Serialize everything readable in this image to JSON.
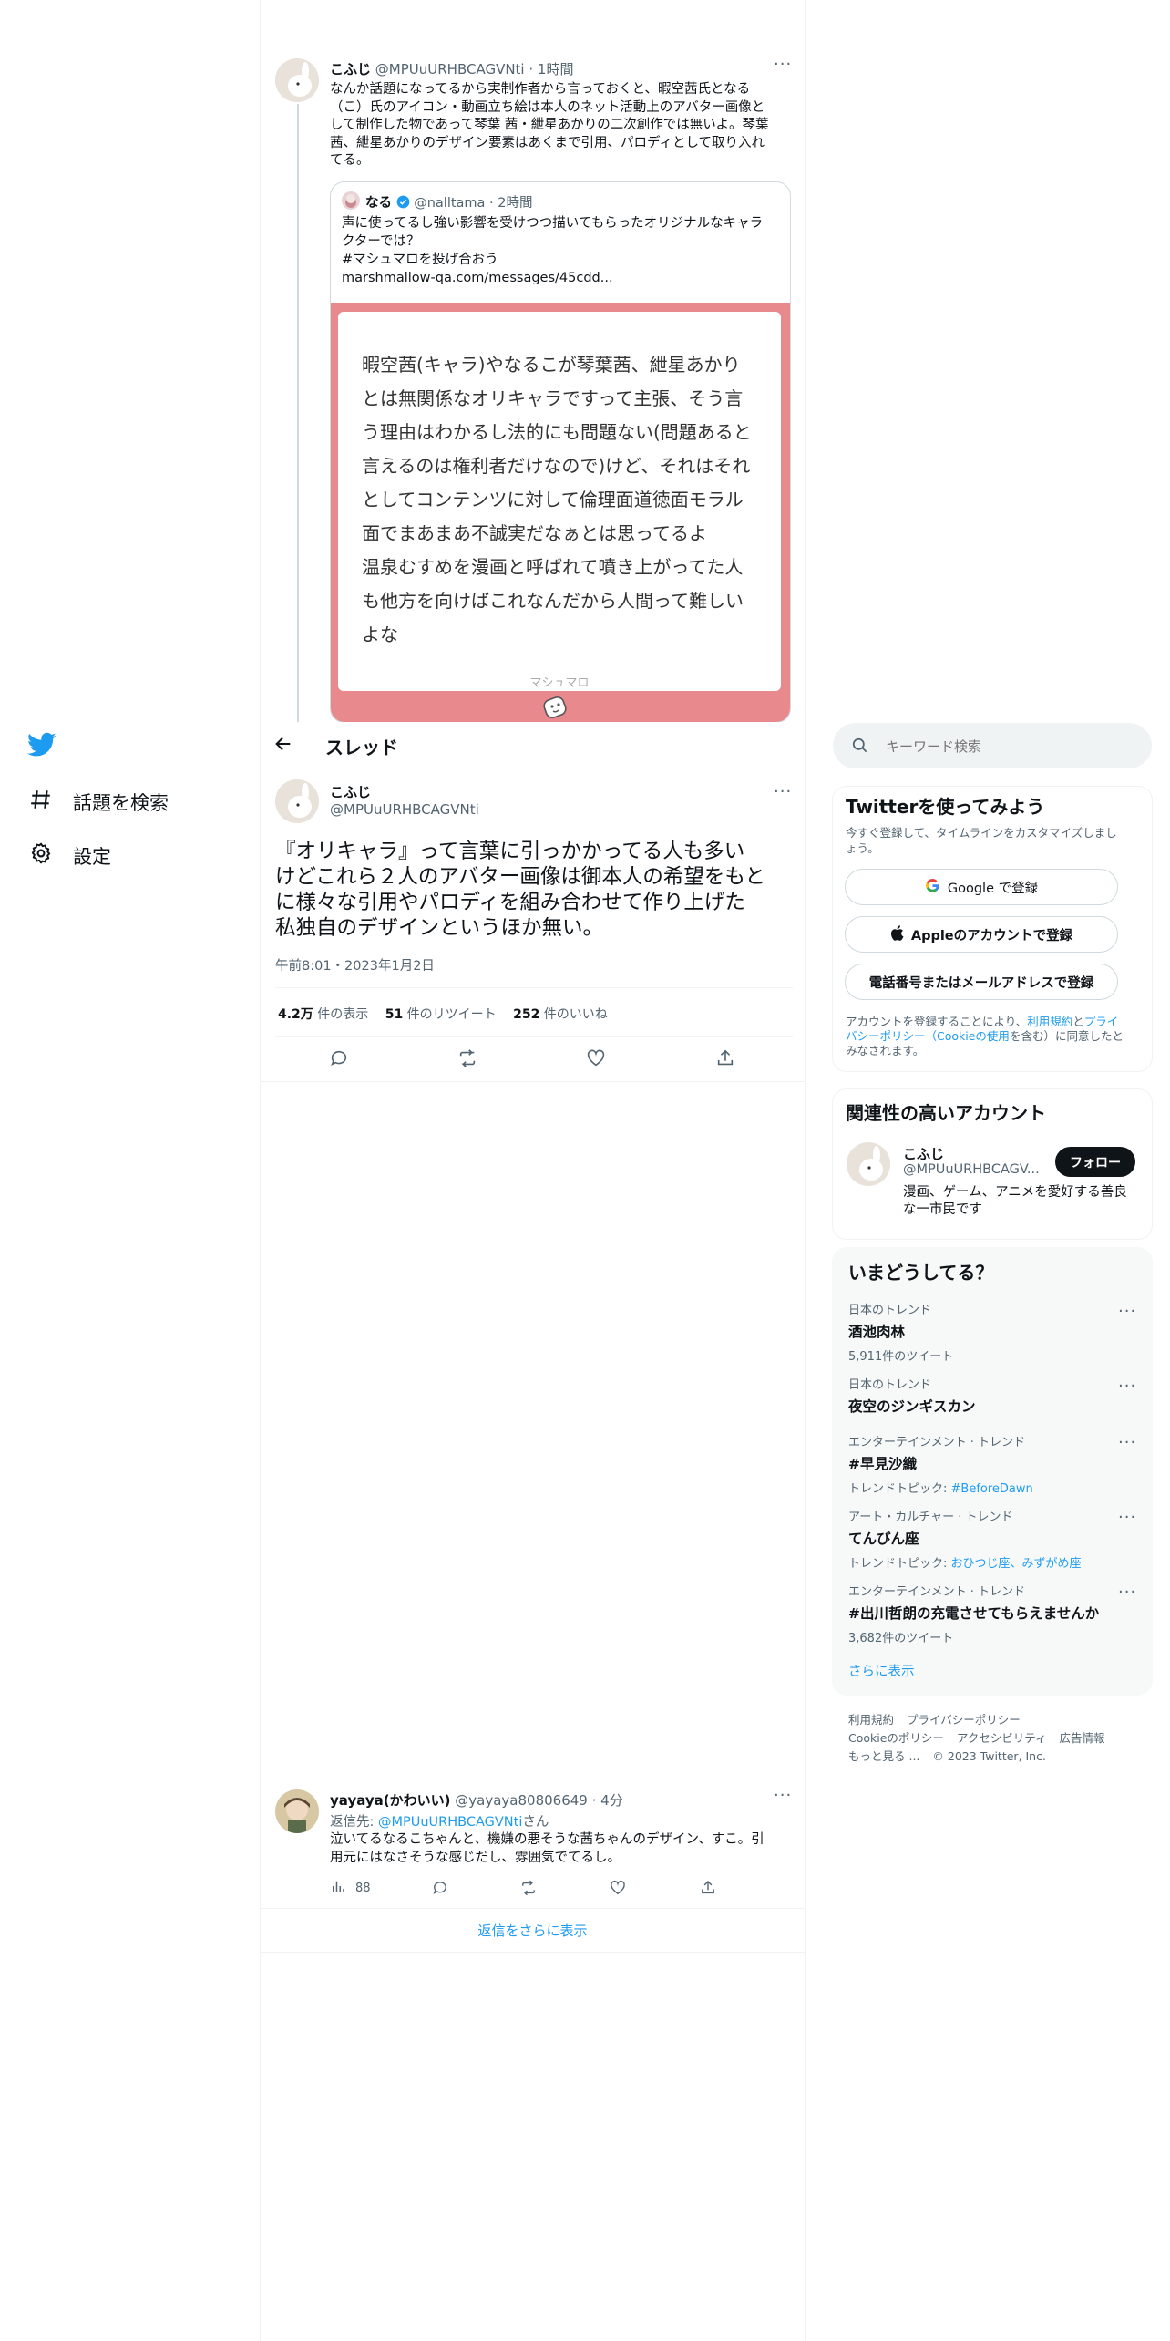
{
  "nav": {
    "explore_label": "話題を検索",
    "settings_label": "設定"
  },
  "thread_header": {
    "title": "スレッド"
  },
  "top_tweet": {
    "name": "こふじ",
    "handle": "@MPUuURHBCAGVNti",
    "time": "· 1時間",
    "lines": [
      "なんか話題になってるから実制作者から言っておくと、暇空茜氏となる",
      "（こ）氏のアイコン・動画立ち絵は本人のネット活動上のアバター画像と",
      "して制作した物であって琴葉 茜・紲星あかりの二次創作では無いよ。琴葉",
      "茜、紲星あかりのデザイン要素はあくまで引用、パロディとして取り入れ",
      "てる。"
    ]
  },
  "quote": {
    "name": "なる",
    "handle": "@nalltama",
    "time": "· 2時間",
    "lines": [
      "声に使ってるし強い影響を受けつつ描いてもらったオリジナルなキャラ",
      "クターでは？",
      "#マシュマロを投げ合おう",
      "marshmallow-qa.com/messages/45cdd..."
    ],
    "marshmallow_lines": [
      "暇空茜(キャラ)やなるこが琴葉茜、紲星あかり",
      "とは無関係なオリキャラですって主張、そう言",
      "う理由はわかるし法的にも問題ない(問題あると",
      "言えるのは権利者だけなので)けど、それはそれ",
      "としてコンテンツに対して倫理面道徳面モラル",
      "面でまあまあ不誠実だなぁとは思ってるよ",
      "温泉むすめを漫画と呼ばれて噴き上がってた人",
      "も他方を向けばこれなんだから人間って難しい",
      "よな"
    ],
    "marshmallow_footer": "マシュマロ"
  },
  "main_tweet": {
    "name": "こふじ",
    "handle": "@MPUuURHBCAGVNti",
    "lines": [
      "『オリキャラ』って言葉に引っかかってる人も多い",
      "けどこれら２人のアバター画像は御本人の希望をもと",
      "に様々な引用やパロディを組み合わせて作り上げた",
      "私独自のデザインというほか無い。"
    ],
    "timestamp": "午前8:01・2023年1月2日",
    "stats": {
      "views_value": "4.2万",
      "views_label": " 件の表示",
      "retweets_value": "51",
      "retweets_label": " 件のリツイート",
      "likes_value": "252",
      "likes_label": " 件のいいね"
    }
  },
  "reply": {
    "name": "yayaya(かわいい)",
    "handle": "@yayaya80806649",
    "time": "· 4分",
    "reply_to_prefix": "返信先: ",
    "reply_to_handle": "@MPUuURHBCAGVNti",
    "reply_to_suffix": "さん",
    "lines": [
      "泣いてるなるこちゃんと、機嫌の悪そうな茜ちゃんのデザイン、すこ。引",
      "用元にはなさそうな感じだし、雰囲気でてるし。"
    ],
    "views": "88"
  },
  "show_more_replies": "返信をさらに表示",
  "search": {
    "placeholder": "キーワード検索"
  },
  "signup": {
    "title": "Twitterを使ってみよう",
    "subtitle_lines": [
      "今すぐ登録して、タイムラインをカスタマイズしまし",
      "ょう。"
    ],
    "google_button": "Google で登録",
    "apple_button": "Appleのアカウントで登録",
    "phone_button": "電話番号またはメールアドレスで登録",
    "legal_line1_pre": "アカウントを登録することにより、",
    "legal_terms": "利用規約",
    "legal_and": "と",
    "legal_privacy": "プライ",
    "legal_line2_privacy": "バシーポリシー（Cookieの使用",
    "legal_line2_post": "を含む）に同意したと",
    "legal_line3": "みなされます。"
  },
  "related": {
    "title": "関連性の高いアカウント",
    "name": "こふじ",
    "handle": "@MPUuURHBCAGV...",
    "follow_button": "フォロー",
    "bio_lines": [
      "漫画、ゲーム、アニメを愛好する善良",
      "な一市民です"
    ]
  },
  "trends": {
    "title": "いまどうしてる？",
    "items": [
      {
        "category": "日本のトレンド",
        "name": "酒池肉林",
        "sub": "5,911件のツイート",
        "sub_link": ""
      },
      {
        "category": "日本のトレンド",
        "name": "夜空のジンギスカン",
        "sub": "",
        "sub_link": ""
      },
      {
        "category": "エンターテインメント · トレンド",
        "name": "#早見沙織",
        "sub": "トレンドトピック: ",
        "sub_link": "#BeforeDawn"
      },
      {
        "category": "アート・カルチャー · トレンド",
        "name": "てんびん座",
        "sub": "トレンドトピック: ",
        "sub_link": "おひつじ座、みずがめ座"
      },
      {
        "category": "エンターテインメント · トレンド",
        "name": "#出川哲朗の充電させてもらえませんか",
        "sub": "3,682件のツイート",
        "sub_link": ""
      }
    ],
    "show_more": "さらに表示"
  },
  "footer": {
    "terms": "利用規約",
    "privacy": "プライバシーポリシー",
    "cookie": "Cookieのポリシー",
    "accessibility": "アクセシビリティ",
    "ads": "広告情報",
    "more": "もっと見る ...",
    "copyright": "© 2023 Twitter, Inc."
  },
  "colors": {
    "accent": "#1d9bf0",
    "marshmallow_bg": "#e8898e",
    "text": "#0f1419",
    "muted": "#536471"
  }
}
